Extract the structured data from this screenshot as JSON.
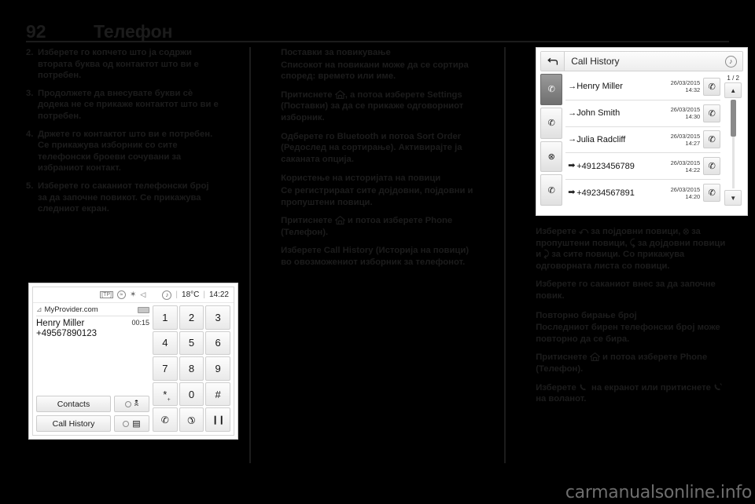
{
  "header": {
    "page_number": "92",
    "title": "Телефон"
  },
  "left_column": {
    "steps": [
      {
        "num": "2.",
        "text": "Изберете го копчето што ја содржи втората буква од контактот што ви е потребен."
      },
      {
        "num": "3.",
        "text": "Продолжете да внесувате букви сѐ додека не се прикаже контактот што ви е потребен."
      },
      {
        "num": "4.",
        "text": "Држете го контактот што ви е потребен. Се прикажува изборник со сите телефонски броеви сочувани за избраниот контакт."
      },
      {
        "num": "5.",
        "text": "Изберете го саканиот телефонски број за да започне повикот. Се прикажува следниот екран."
      }
    ]
  },
  "middle_column": {
    "heading_1": "Поставки за повикување",
    "para_1": "Списокот на повикани може да се сортира според: времето или име.",
    "para_2_before": "Притиснете ",
    "para_2_after": ", а потоа изберете Settings (Поставки) за да се прикаже одговорниот изборник.",
    "para_3": "Одберете го Bluetooth и потоа Sort Order (Редослед на сортирање). Активирајте ја саканата опција.",
    "heading_2": "Користење на историјата на повици",
    "para_4": "Се регистрираат сите дојдовни, појдовни и пропуштени повици.",
    "para_5_before": "Притиснете ",
    "para_5_after": " и потоа изберете Phone (Телефон).",
    "para_6": "Изберете Call History (Историја на повици) во овозможениот изборник за телефонот."
  },
  "right_column": {
    "para_1": "Изберете ⤺ за појдовни повици, ⊗ за пропуштени повици, ⤹ за дојдовни повици и ⤸ за сите повици. Со прикажува одговорната листа со повици.",
    "para_2": "Изберете го саканиот внес за да започне повик.",
    "heading_1": "Повторно бирање број",
    "para_3": "Последниот бирен телефонски број може повторно да се бира.",
    "para_4_before": "Притиснете ",
    "para_4_after": " и потоа изберете Phone (Телефон).",
    "para_5_before": "Изберете ",
    "para_5_mid": " на екранот или притиснете ",
    "para_5_after": " на воланот."
  },
  "call_history_screen": {
    "back_icon": "back-arrow-icon",
    "title": "Call History",
    "note_icon": "music-note-icon",
    "side_tabs": [
      {
        "icon": "outgoing-calls-icon",
        "active": true
      },
      {
        "icon": "incoming-calls-icon",
        "active": false
      },
      {
        "icon": "missed-calls-icon",
        "active": false
      },
      {
        "icon": "all-calls-icon",
        "active": false
      }
    ],
    "rows": [
      {
        "arrow": "→",
        "name": "Henry Miller",
        "date": "26/03/2015",
        "time": "14:32",
        "call_icon": "handset-icon"
      },
      {
        "arrow": "→",
        "name": "John Smith",
        "date": "26/03/2015",
        "time": "14:30",
        "call_icon": "handset-icon"
      },
      {
        "arrow": "→",
        "name": "Julia Radcliff",
        "date": "26/03/2015",
        "time": "14:27",
        "call_icon": "handset-icon"
      },
      {
        "arrow": "➡",
        "name": "+49123456789",
        "date": "26/03/2015",
        "time": "14:22",
        "call_icon": "handset-icon"
      },
      {
        "arrow": "➡",
        "name": "+49234567891",
        "date": "26/03/2015",
        "time": "14:20",
        "call_icon": "handset-icon"
      }
    ],
    "page_indicator": "1 / 2",
    "scroll_up": "▲",
    "scroll_down": "▼"
  },
  "call_screen": {
    "status_icons": [
      "tp-icon",
      "traffic-icon",
      "bluetooth-icon",
      "mute-icon"
    ],
    "status_tp": "[TP]",
    "media_icon": "music-note-icon",
    "temperature": "18°C",
    "clock": "14:22",
    "separator": "|",
    "provider": "MyProvider.com",
    "signal_icon": "signal-bars-icon",
    "battery_icon": "battery-icon",
    "caller_name": "Henry Miller",
    "call_duration": "00:15",
    "caller_number": "+49567890123",
    "buttons": {
      "contacts": "Contacts",
      "call_history": "Call History",
      "mute_icon": "mic-mute-icon",
      "speaker_icon": "handset-speaker-icon"
    },
    "keypad": [
      "1",
      "2",
      "3",
      "4",
      "5",
      "6",
      "7",
      "8",
      "9",
      "*",
      "0",
      "#"
    ],
    "keypad_star_sup": "+",
    "action_keys": {
      "accept": "handset-accept-icon",
      "end": "handset-end-icon",
      "hold": "pause-icon"
    }
  },
  "footer": {
    "watermark": "carmanualsonline.info"
  }
}
